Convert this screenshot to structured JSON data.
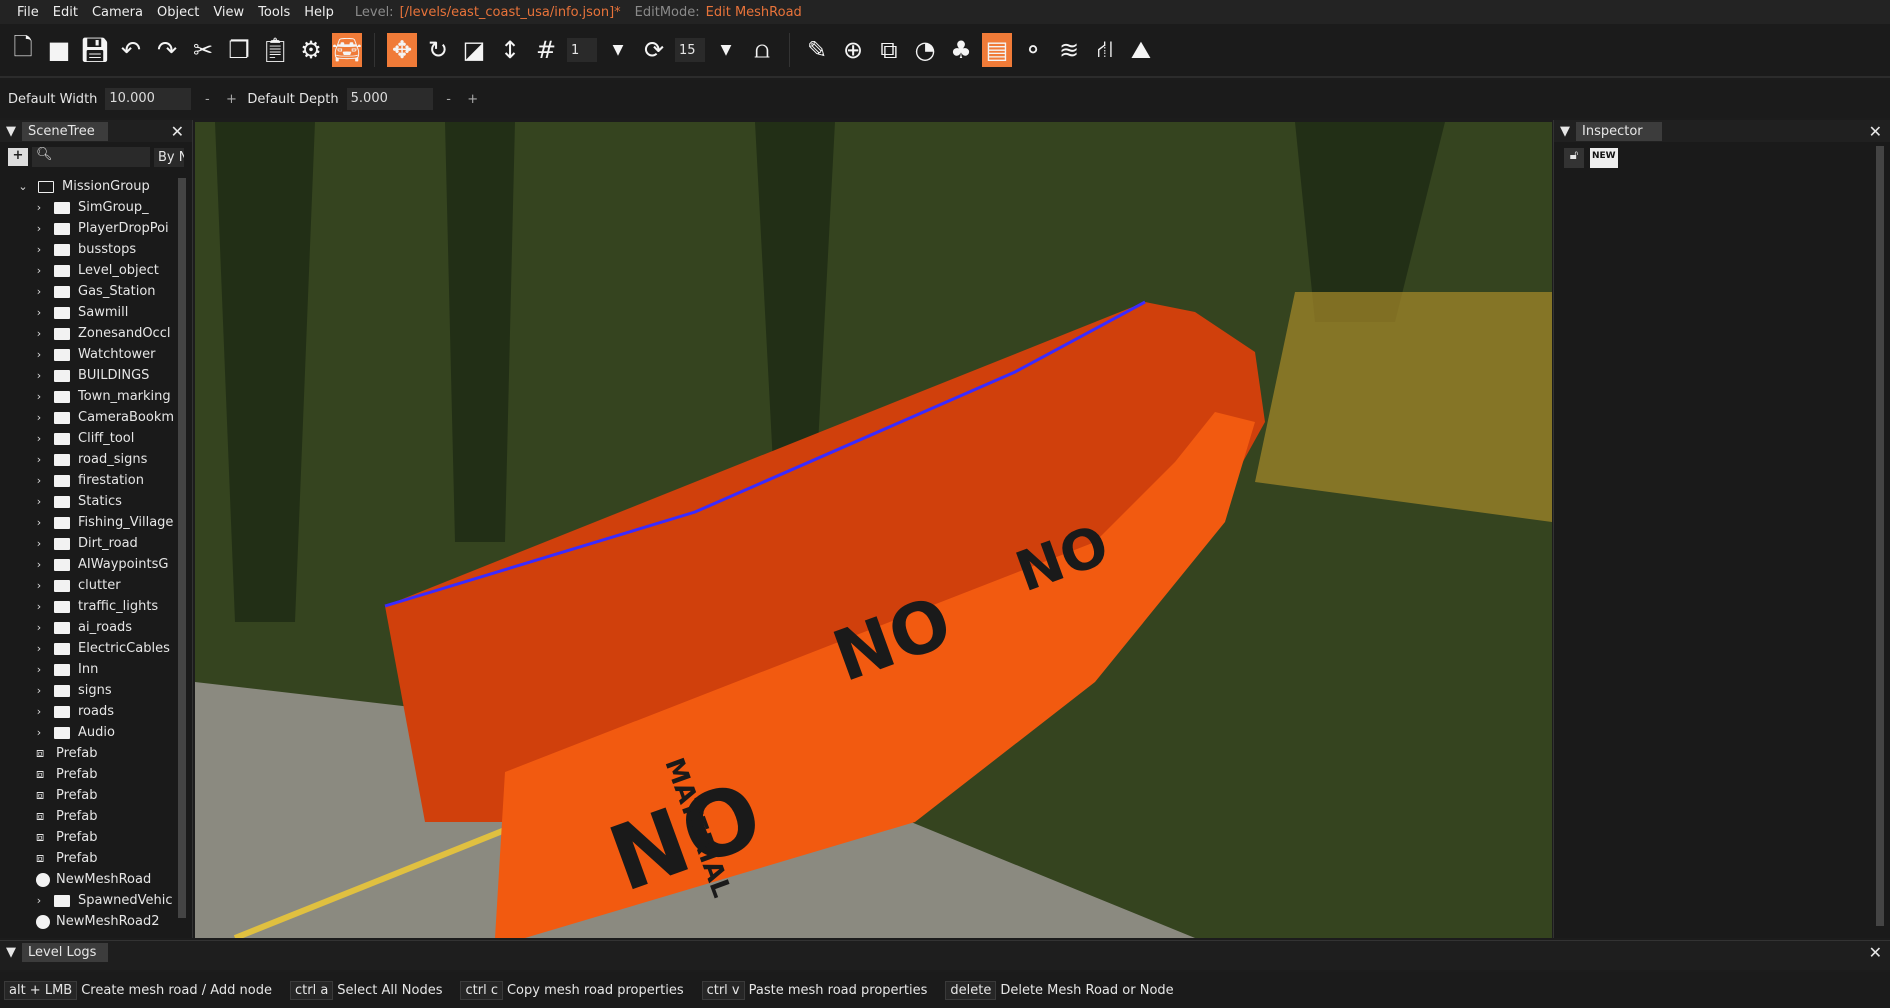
{
  "menu": [
    "File",
    "Edit",
    "Camera",
    "Object",
    "View",
    "Tools",
    "Help"
  ],
  "level_label": "Level:",
  "level_path": "[/levels/east_coast_usa/info.json]*",
  "editmode_label": "EditMode:",
  "editmode_value": "Edit MeshRoad",
  "toolbar": {
    "snap_value": "1",
    "rotate_snap_value": "15"
  },
  "options": {
    "width_label": "Default Width",
    "width_value": "10.000",
    "depth_label": "Default Depth",
    "depth_value": "5.000",
    "minus": "-",
    "plus": "+"
  },
  "scenetree": {
    "title": "SceneTree",
    "filter": "By N",
    "root": "MissionGroup",
    "items": [
      {
        "label": "SimGroup_",
        "type": "folder"
      },
      {
        "label": "PlayerDropPoi",
        "type": "folder"
      },
      {
        "label": "busstops",
        "type": "folder"
      },
      {
        "label": "Level_object",
        "type": "folder"
      },
      {
        "label": "Gas_Station",
        "type": "folder"
      },
      {
        "label": "Sawmill",
        "type": "folder"
      },
      {
        "label": "ZonesandOccl",
        "type": "folder"
      },
      {
        "label": "Watchtower",
        "type": "folder"
      },
      {
        "label": "BUILDINGS",
        "type": "folder"
      },
      {
        "label": "Town_marking",
        "type": "folder"
      },
      {
        "label": "CameraBookm",
        "type": "folder"
      },
      {
        "label": "Cliff_tool",
        "type": "folder"
      },
      {
        "label": "road_signs",
        "type": "folder"
      },
      {
        "label": "firestation",
        "type": "folder"
      },
      {
        "label": "Statics",
        "type": "folder"
      },
      {
        "label": "Fishing_Village",
        "type": "folder"
      },
      {
        "label": "Dirt_road",
        "type": "folder"
      },
      {
        "label": "AIWaypointsG",
        "type": "folder"
      },
      {
        "label": "clutter",
        "type": "folder"
      },
      {
        "label": "traffic_lights",
        "type": "folder"
      },
      {
        "label": "ai_roads",
        "type": "folder"
      },
      {
        "label": "ElectricCables",
        "type": "folder"
      },
      {
        "label": "Inn",
        "type": "folder"
      },
      {
        "label": "signs",
        "type": "folder"
      },
      {
        "label": "roads",
        "type": "folder"
      },
      {
        "label": "Audio",
        "type": "folder"
      },
      {
        "label": "Prefab",
        "type": "prefab"
      },
      {
        "label": "Prefab",
        "type": "prefab"
      },
      {
        "label": "Prefab",
        "type": "prefab"
      },
      {
        "label": "Prefab",
        "type": "prefab"
      },
      {
        "label": "Prefab",
        "type": "prefab"
      },
      {
        "label": "Prefab",
        "type": "prefab"
      },
      {
        "label": "NewMeshRoad",
        "type": "road"
      },
      {
        "label": "SpawnedVehic",
        "type": "folder"
      },
      {
        "label": "NewMeshRoad2",
        "type": "road"
      }
    ]
  },
  "inspector": {
    "title": "Inspector",
    "new_label": "NEW"
  },
  "viewport": {
    "texture_text": "NO",
    "texture_subtext": "MATERIAL"
  },
  "logs": {
    "title": "Level Logs"
  },
  "shortcuts": [
    {
      "key": "alt + LMB",
      "action": "Create mesh road / Add node"
    },
    {
      "key": "ctrl a",
      "action": "Select All Nodes"
    },
    {
      "key": "ctrl c",
      "action": "Copy mesh road properties"
    },
    {
      "key": "ctrl v",
      "action": "Paste mesh road properties"
    },
    {
      "key": "delete",
      "action": "Delete Mesh Road or Node"
    }
  ]
}
